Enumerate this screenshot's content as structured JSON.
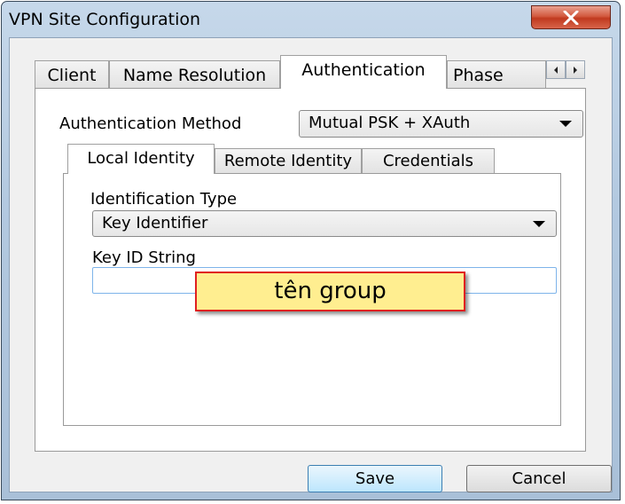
{
  "window": {
    "title": "VPN Site Configuration"
  },
  "main_tabs": [
    {
      "label": "Client"
    },
    {
      "label": "Name Resolution"
    },
    {
      "label": "Authentication"
    },
    {
      "label": "Phase"
    }
  ],
  "active_main_tab": "Authentication",
  "authentication": {
    "method_label": "Authentication Method",
    "method_value": "Mutual PSK + XAuth",
    "sub_tabs": [
      {
        "label": "Local Identity"
      },
      {
        "label": "Remote Identity"
      },
      {
        "label": "Credentials"
      }
    ],
    "active_sub_tab": "Local Identity",
    "identification_type_label": "Identification Type",
    "identification_type_value": "Key Identifier",
    "key_id_label": "Key ID String",
    "key_id_value": ""
  },
  "annotation": {
    "text": "tên group"
  },
  "buttons": {
    "save": "Save",
    "cancel": "Cancel"
  },
  "colors": {
    "close_button": "#c03a1f",
    "callout_border": "#e02020",
    "callout_fill": "#ffee90",
    "input_border": "#7eb4ea"
  }
}
